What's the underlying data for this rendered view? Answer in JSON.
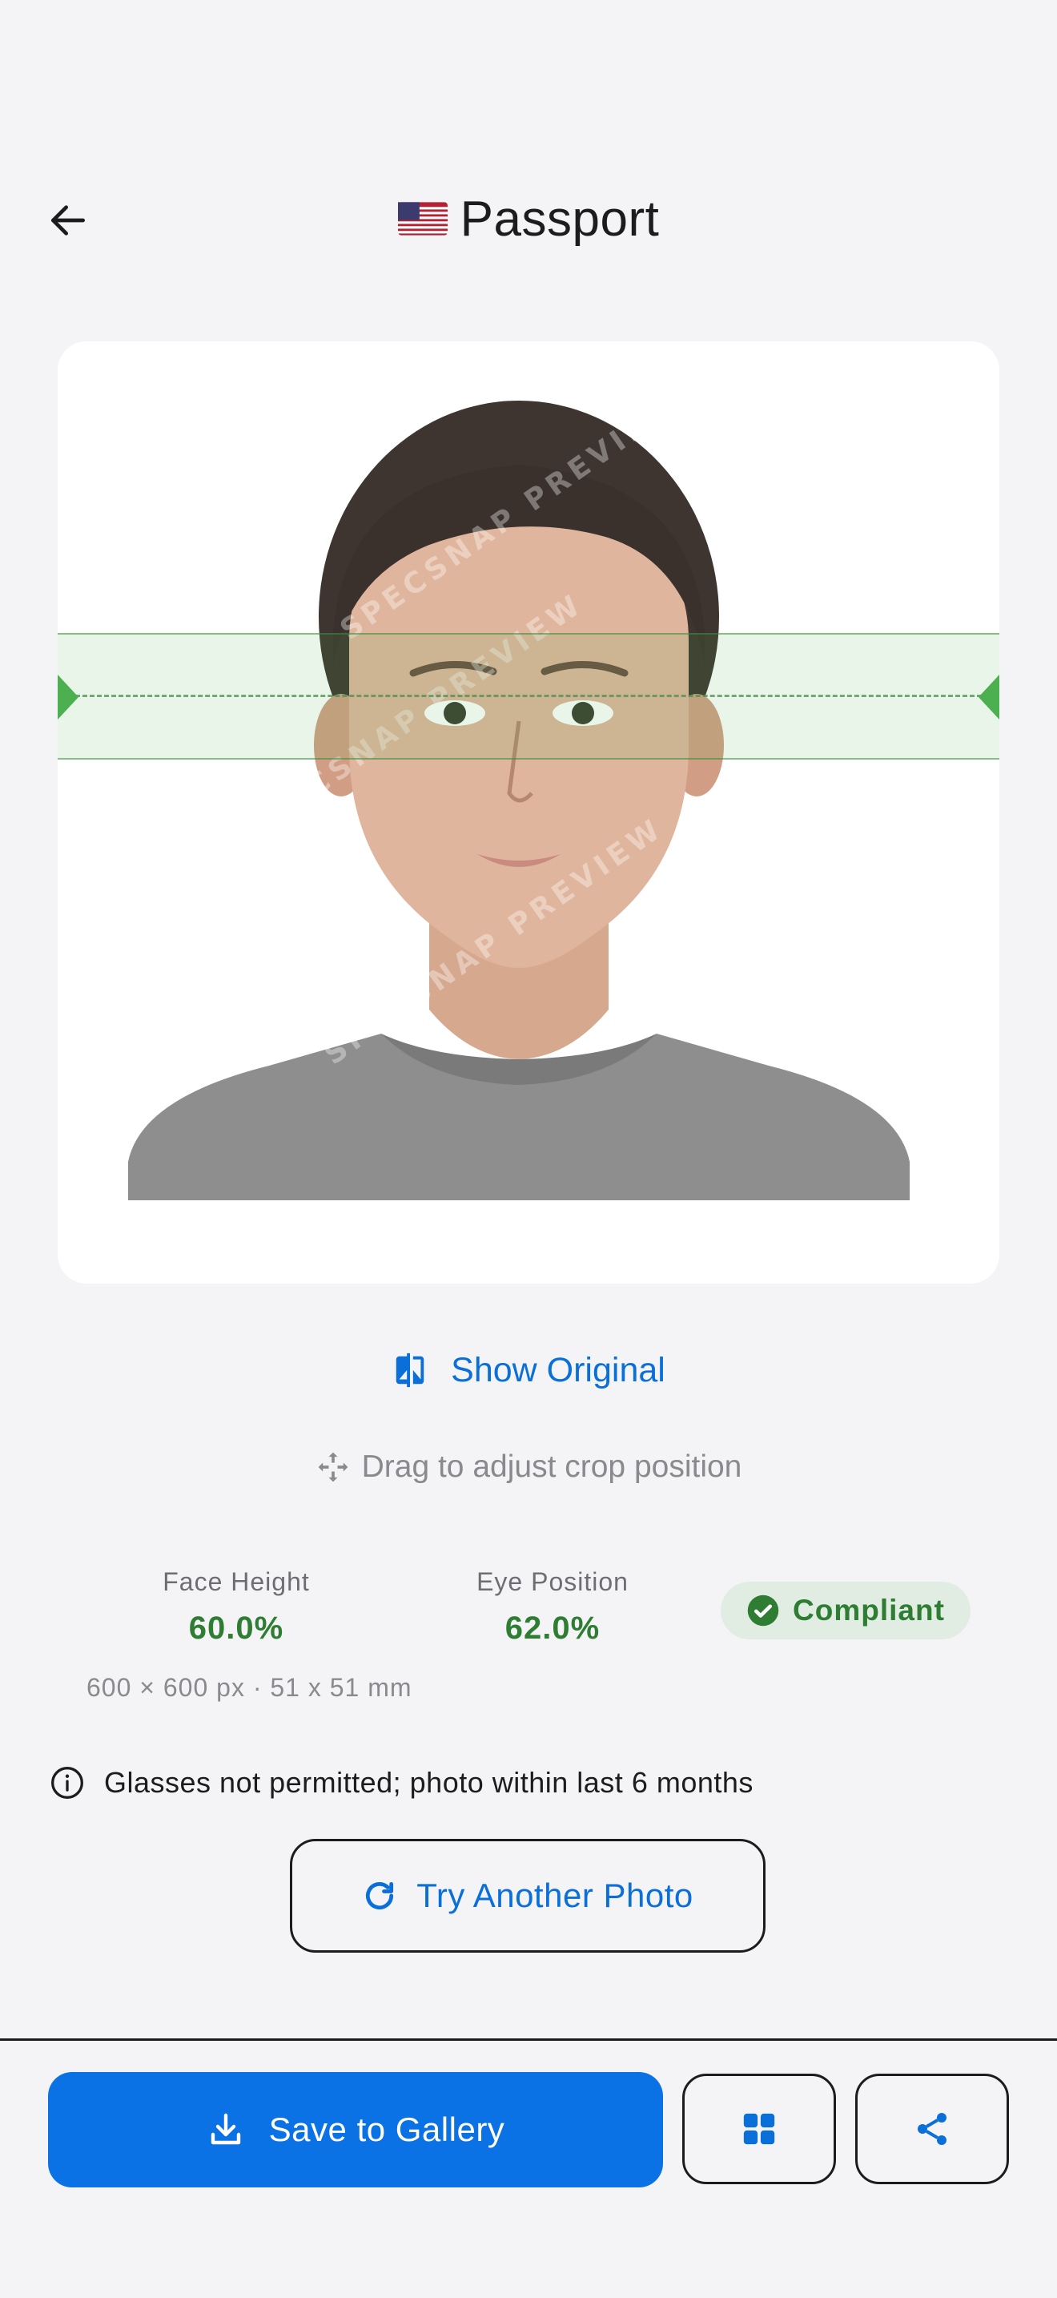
{
  "header": {
    "title": "Passport",
    "flag_icon": "us-flag-icon",
    "back_icon": "arrow-left-icon"
  },
  "preview": {
    "watermark": "SPECSNAP PREVIEW",
    "show_original_label": "Show Original",
    "drag_hint": "Drag to adjust crop position"
  },
  "stats": {
    "face_height_label": "Face Height",
    "face_height_value": "60.0%",
    "eye_position_label": "Eye Position",
    "eye_position_value": "62.0%",
    "status_label": "Compliant",
    "dimensions": "600 × 600 px · 51 x 51 mm"
  },
  "info": {
    "text": "Glasses not permitted; photo within last 6 months"
  },
  "actions": {
    "try_another_label": "Try Another Photo",
    "save_label": "Save to Gallery",
    "grid_icon": "grid-icon",
    "share_icon": "share-icon"
  },
  "colors": {
    "accent": "#0a72e4",
    "success": "#2e7d32",
    "background": "#f4f4f7"
  }
}
